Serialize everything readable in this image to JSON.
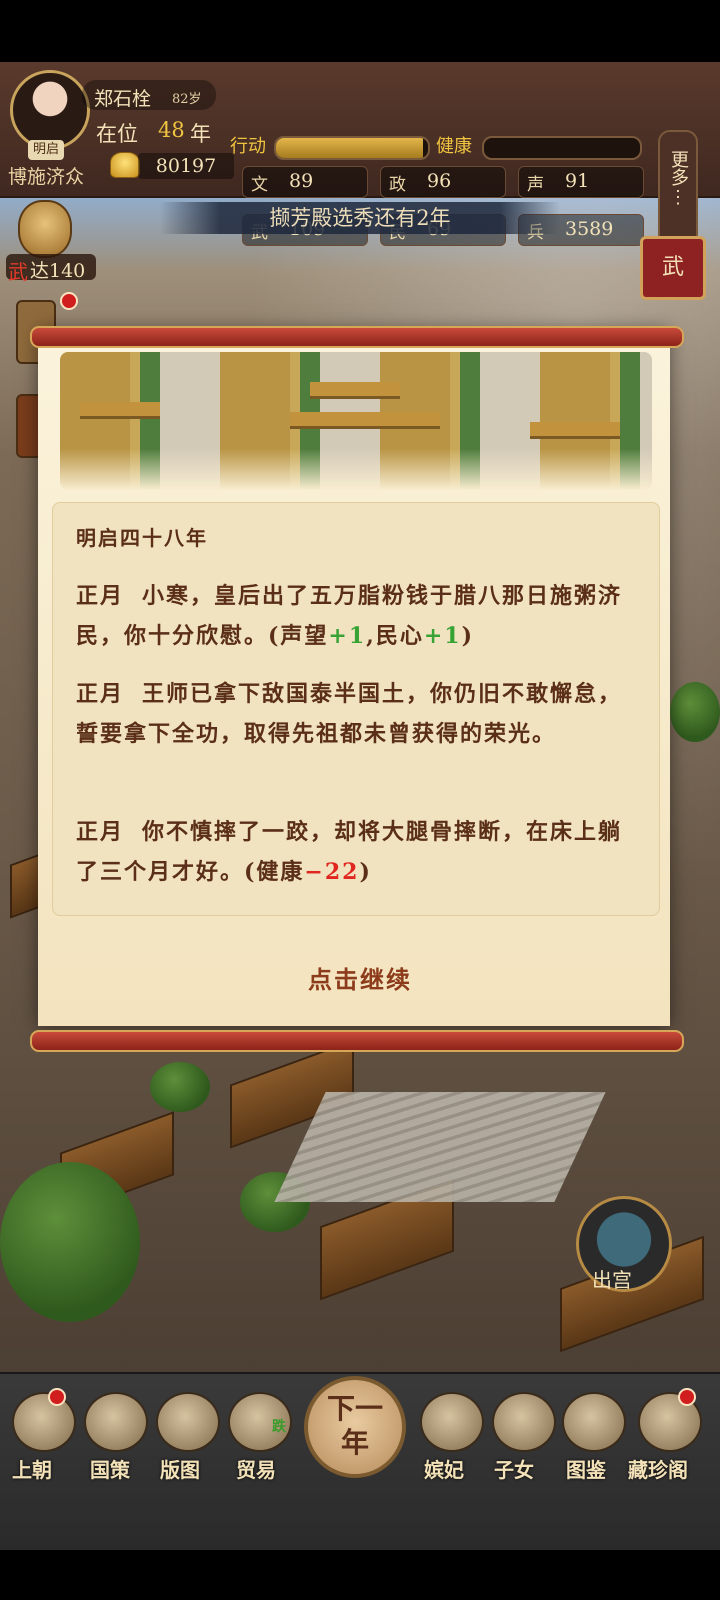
{
  "player": {
    "name": "郑石栓",
    "age": "82岁",
    "era_name": "明启",
    "reign_label": "在位",
    "reign_years": "48",
    "reign_unit": "年",
    "title": "博施济众",
    "gold": "80197"
  },
  "bars": {
    "action_label": "行动",
    "health_label": "健康",
    "action_level": 0.97,
    "health_level": 0.0
  },
  "stats": [
    {
      "key": "文",
      "value": "89"
    },
    {
      "key": "政",
      "value": "96"
    },
    {
      "key": "声",
      "value": "91"
    },
    {
      "key": "武",
      "value": "109"
    },
    {
      "key": "民",
      "value": "69"
    },
    {
      "key": "兵",
      "value": "3589"
    }
  ],
  "more_label": "更多",
  "more_dots": "⋮",
  "banner_text": "撷芳殿选秀还有2年",
  "side": {
    "wuda_key": "武",
    "wuda_value": "达140",
    "wu_button": "武"
  },
  "modal": {
    "year": "明启四十八年",
    "entries": [
      {
        "month": "正月",
        "text": "小寒，皇后出了五万脂粉钱于腊八那日施粥济民，你十分欣慰。(声望",
        "p1": "+1",
        "mid": ",民心",
        "p2": "+1",
        "end": ")"
      },
      {
        "month": "正月",
        "text": "王师已拿下敌国泰半国土，你仍旧不敢懈怠，誓要拿下全功，取得先祖都未曾获得的荣光。"
      },
      {
        "month": "正月",
        "text": "你不慎摔了一跤，却将大腿骨摔断，在床上躺了三个月才好。(健康",
        "m1": "−22",
        "end": ")"
      }
    ],
    "continue_label": "点击继续"
  },
  "exit_label": "出宫",
  "nav": {
    "court": "上朝",
    "policy": "国策",
    "territory": "版图",
    "trade": "贸易",
    "trade_badge": "跌",
    "next_year": "下一年",
    "consorts": "嫔妃",
    "children": "子女",
    "gallery": "图鉴",
    "treasure": "藏珍阁"
  },
  "colors": {
    "accent_gold": "#f0c440",
    "text_brown": "#5a2e18",
    "plus_green": "#36a334",
    "minus_red": "#e0261f"
  }
}
